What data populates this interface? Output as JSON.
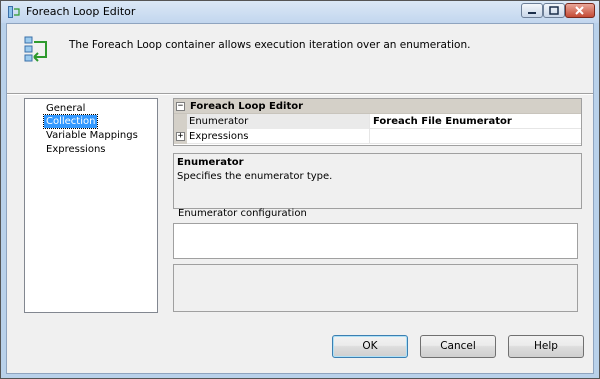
{
  "window": {
    "title": "Foreach Loop Editor"
  },
  "header": {
    "description": "The Foreach Loop container allows execution iteration over an enumeration."
  },
  "nav": {
    "items": [
      {
        "label": "General",
        "selected": false
      },
      {
        "label": "Collection",
        "selected": true
      },
      {
        "label": "Variable Mappings",
        "selected": false
      },
      {
        "label": "Expressions",
        "selected": false
      }
    ]
  },
  "grid": {
    "category": "Foreach Loop Editor",
    "rows": [
      {
        "key": "Enumerator",
        "value": "Foreach File Enumerator"
      },
      {
        "key": "Expressions",
        "value": ""
      }
    ],
    "expand_collapse": "−",
    "expand_plus": "+"
  },
  "description": {
    "title": "Enumerator",
    "text": "Specifies the enumerator type."
  },
  "config": {
    "label": "Enumerator configuration"
  },
  "buttons": {
    "ok": "OK",
    "cancel": "Cancel",
    "help": "Help"
  },
  "colors": {
    "selection": "#3399ff",
    "title_bar": "#c2d6ee",
    "close_button": "#c44a34"
  }
}
